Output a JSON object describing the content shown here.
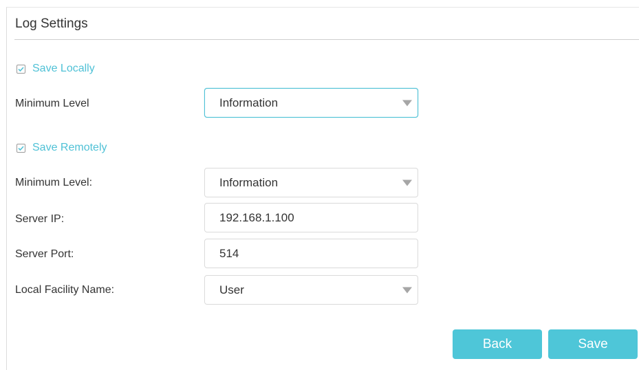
{
  "section_title": "Log Settings",
  "save_locally": {
    "label": "Save Locally",
    "checked": true,
    "minimum_level_label": "Minimum Level",
    "minimum_level_value": "Information"
  },
  "save_remotely": {
    "label": "Save Remotely",
    "checked": true,
    "minimum_level_label": "Minimum Level:",
    "minimum_level_value": "Information",
    "server_ip_label": "Server IP:",
    "server_ip_value": "192.168.1.100",
    "server_port_label": "Server Port:",
    "server_port_value": "514",
    "facility_label": "Local Facility Name:",
    "facility_value": "User"
  },
  "buttons": {
    "back": "Back",
    "save": "Save"
  },
  "colors": {
    "accent": "#4fc1d6",
    "button": "#4ec6d8"
  }
}
